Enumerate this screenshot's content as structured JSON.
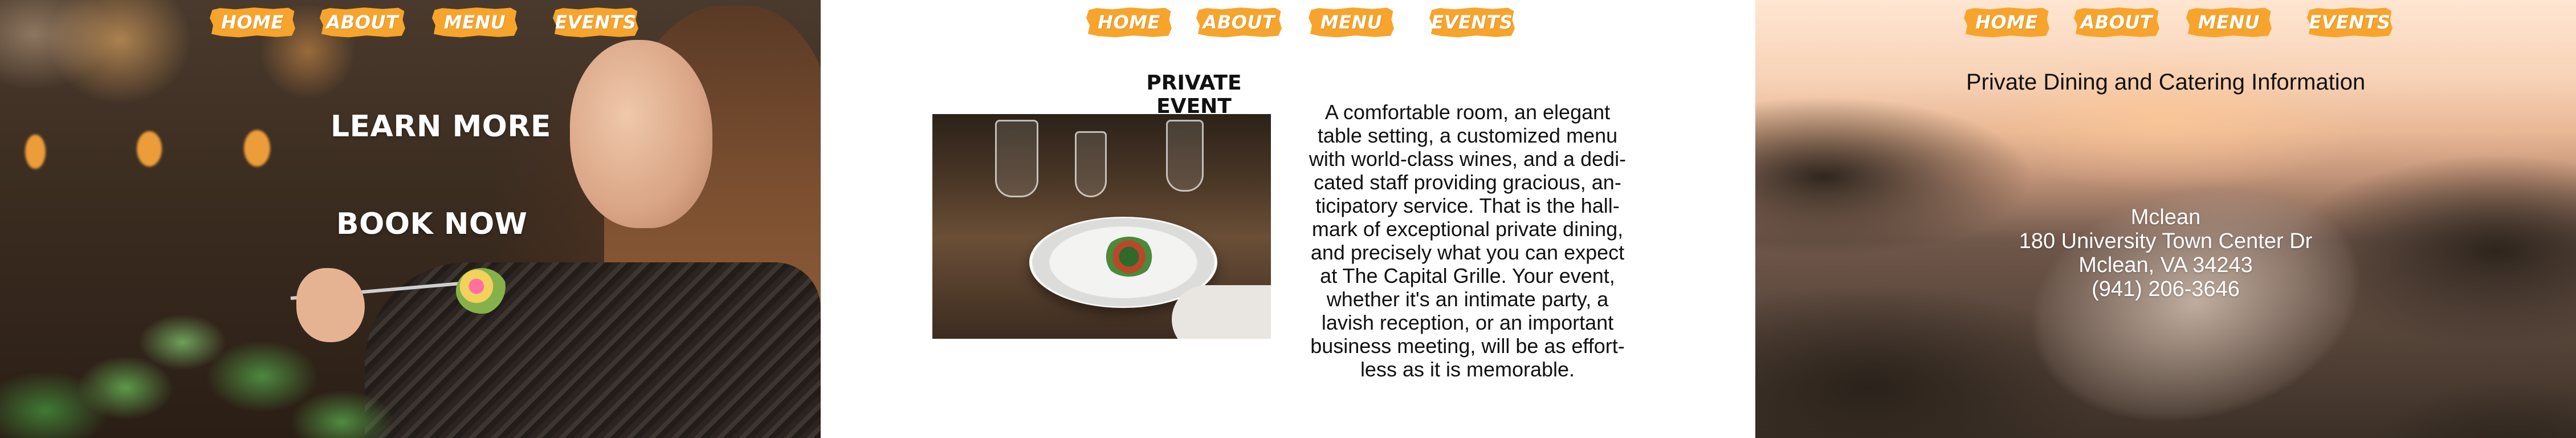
{
  "colors": {
    "nav_orange": "#F7A42C",
    "text_dark": "#111111",
    "text_light": "#FFFFFF"
  },
  "nav": {
    "items": [
      {
        "label": "HOME"
      },
      {
        "label": "ABOUT"
      },
      {
        "label": "MENU"
      },
      {
        "label": "EVENTS"
      }
    ]
  },
  "panel1": {
    "learn_more": "LEARN MORE",
    "book_now": "BOOK NOW"
  },
  "panel2": {
    "heading": "PRIVATE EVENT",
    "body_lines": [
      "A comfortable room, an elegant",
      "table setting, a customized menu",
      "with world-class wines, and a dedi-",
      "cated staff providing gracious, an-",
      "ticipatory service. That is the hall-",
      "mark of exceptional private dining,",
      "and precisely what you can expect",
      "at The Capital Grille. Your event,",
      "whether it's an intimate party, a",
      "lavish reception, or an important",
      "business meeting, will be as effort-",
      "less as it is memorable."
    ]
  },
  "panel3": {
    "title": "Private Dining and Catering Information",
    "address": {
      "name": "Mclean",
      "street": "180 University Town Center Dr",
      "city": "Mclean, VA 34243",
      "phone": "(941) 206-3646"
    }
  }
}
